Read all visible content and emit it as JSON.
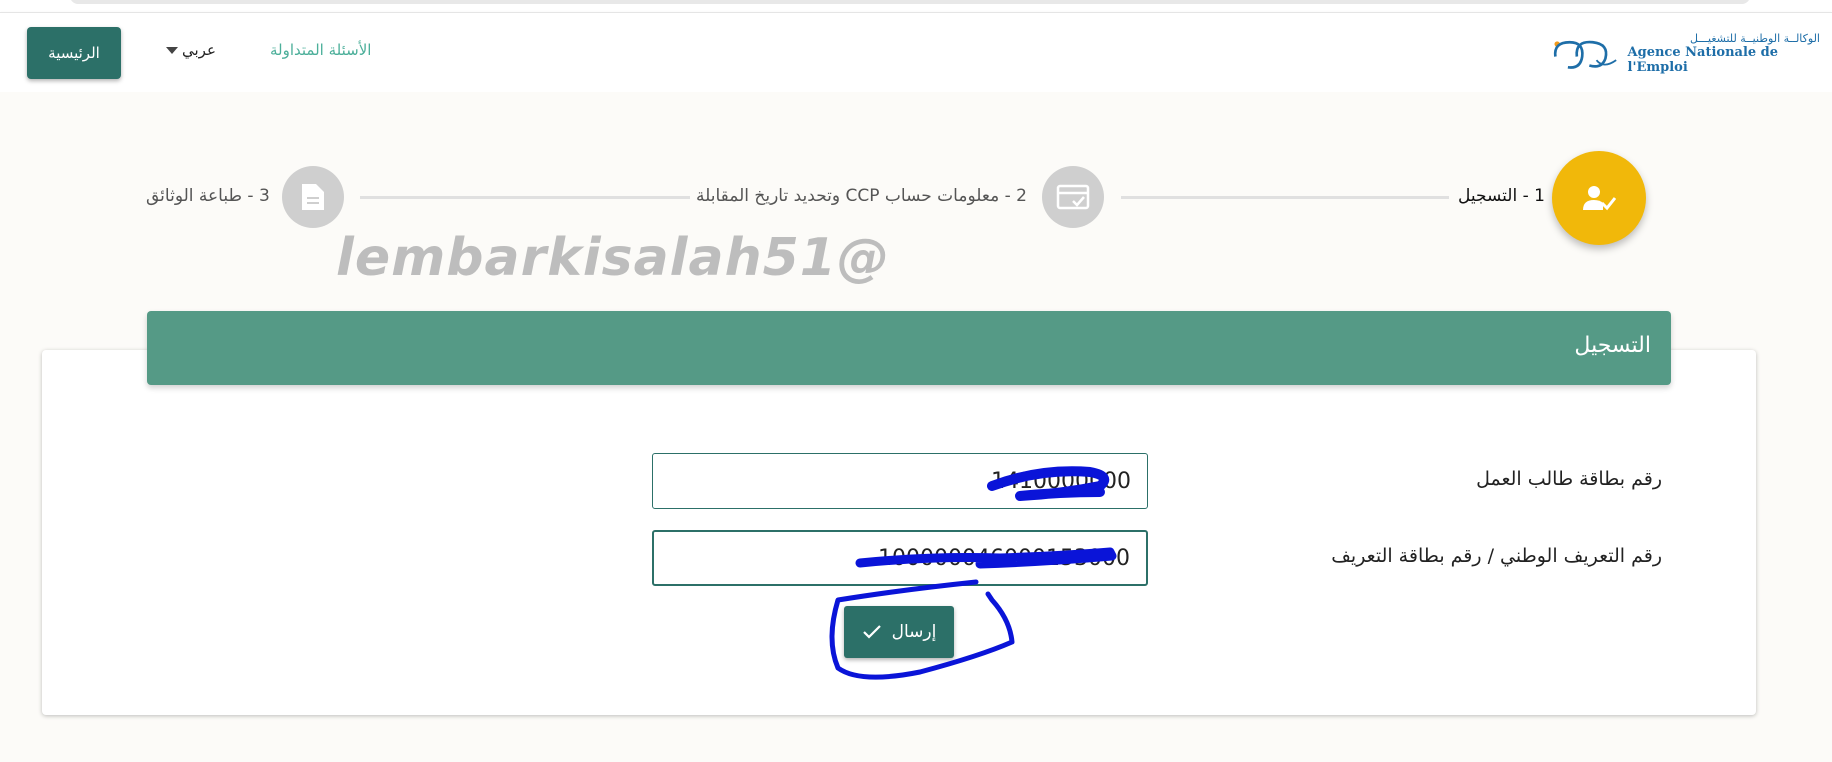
{
  "header": {
    "home_label": "الرئيسية",
    "language_label": "عربي",
    "faq_label": "الأسئلة المتداولة",
    "logo_ar": "الوكالــة الوطنيــة للتشغيـــل",
    "logo_fr": "Agence Nationale de l'Emploi"
  },
  "stepper": {
    "steps": [
      {
        "label": "1 - التسجيل",
        "icon": "user-check-icon",
        "state": "active"
      },
      {
        "label": "2 - معلومات حساب CCP وتحديد تاريخ المقابلة",
        "icon": "card-check-icon",
        "state": "pending"
      },
      {
        "label": "3 - طباعة الوثائق",
        "icon": "document-icon",
        "state": "pending"
      }
    ]
  },
  "watermark": "lembarkisalah51@",
  "form": {
    "title": "التسجيل",
    "job_card_label": "رقم بطاقة طالب العمل",
    "job_card_value": "1410000000",
    "national_id_label": "رقم التعريف الوطني / رقم بطاقة التعريف",
    "national_id_value": "100000046000153000",
    "submit_label": "إرسال"
  },
  "colors": {
    "primary": "#2c7068",
    "card_header": "#559a86",
    "step_active": "#f1b80a",
    "step_pending": "#cfcfcf",
    "link": "#4caf9a",
    "scribble": "#0a14d8"
  }
}
